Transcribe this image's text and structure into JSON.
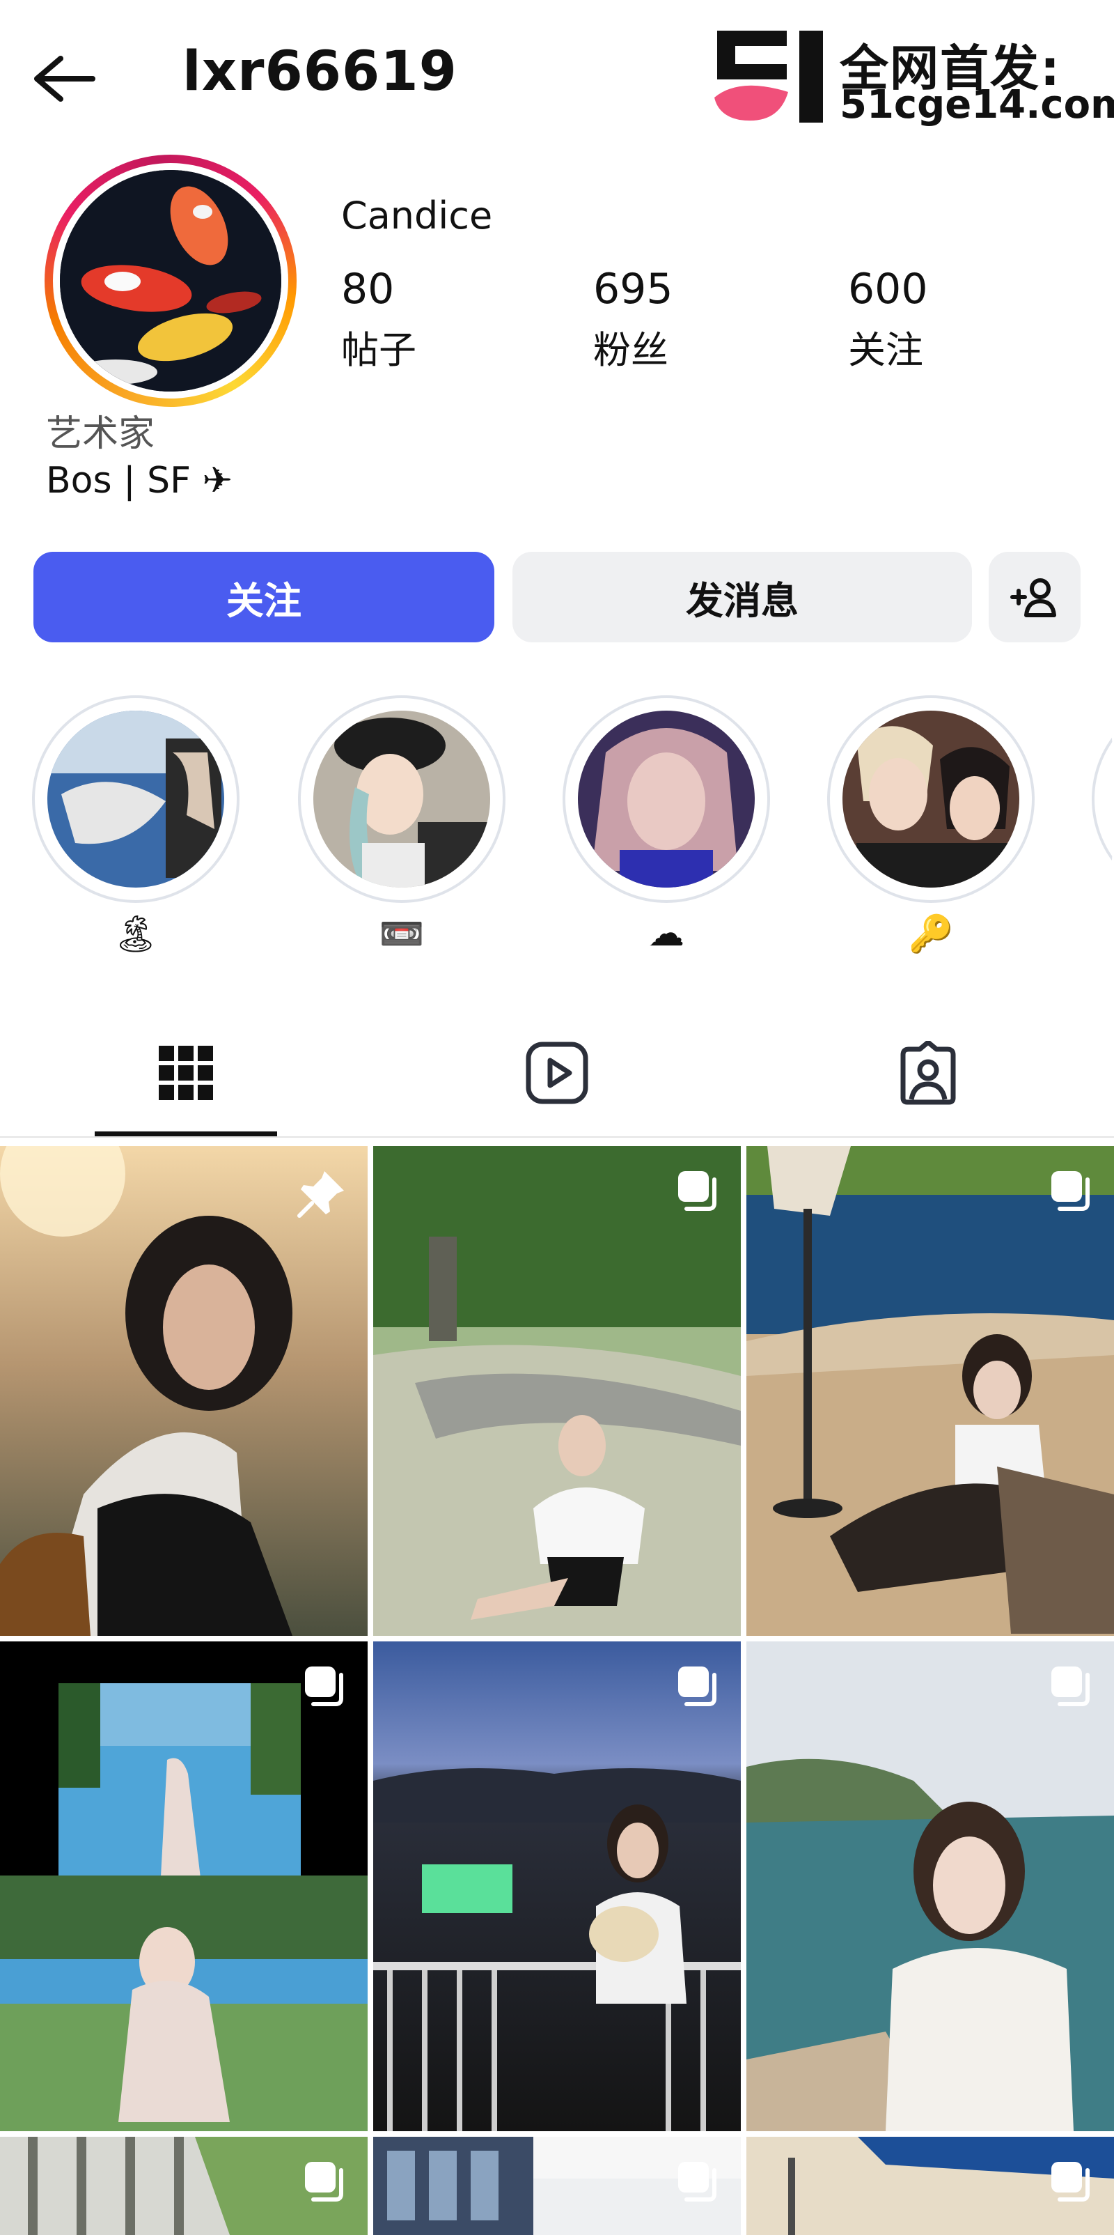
{
  "header": {
    "username": "lxr66619",
    "back_icon": "arrow-left-icon"
  },
  "watermark": {
    "line1": "全网首发:",
    "line2": "51cge14.com"
  },
  "profile": {
    "display_name": "Candice",
    "stats": [
      {
        "value": "80",
        "label": "帖子"
      },
      {
        "value": "695",
        "label": "粉丝"
      },
      {
        "value": "600",
        "label": "关注"
      }
    ],
    "category": "艺术家",
    "bio": "Bos | SF ✈"
  },
  "actions": {
    "follow": "关注",
    "message": "发消息",
    "add_person_icon": "add-person-icon"
  },
  "highlights": [
    {
      "emoji": "🏝"
    },
    {
      "emoji": "📼"
    },
    {
      "emoji": "☁"
    },
    {
      "emoji": "🔑"
    }
  ],
  "tabs": [
    {
      "icon": "grid-icon",
      "active": true
    },
    {
      "icon": "reels-icon",
      "active": false
    },
    {
      "icon": "tagged-icon",
      "active": false
    }
  ],
  "posts": [
    {
      "badge": "pin-icon"
    },
    {
      "badge": "carousel-icon"
    },
    {
      "badge": "carousel-icon"
    },
    {
      "badge": "carousel-icon"
    },
    {
      "badge": "carousel-icon"
    },
    {
      "badge": "carousel-icon"
    },
    {
      "badge": "carousel-icon"
    },
    {
      "badge": "carousel-icon"
    },
    {
      "badge": "carousel-icon"
    }
  ],
  "colors": {
    "accent": "#4a5cf0",
    "secondary_button": "#eff0f2"
  }
}
